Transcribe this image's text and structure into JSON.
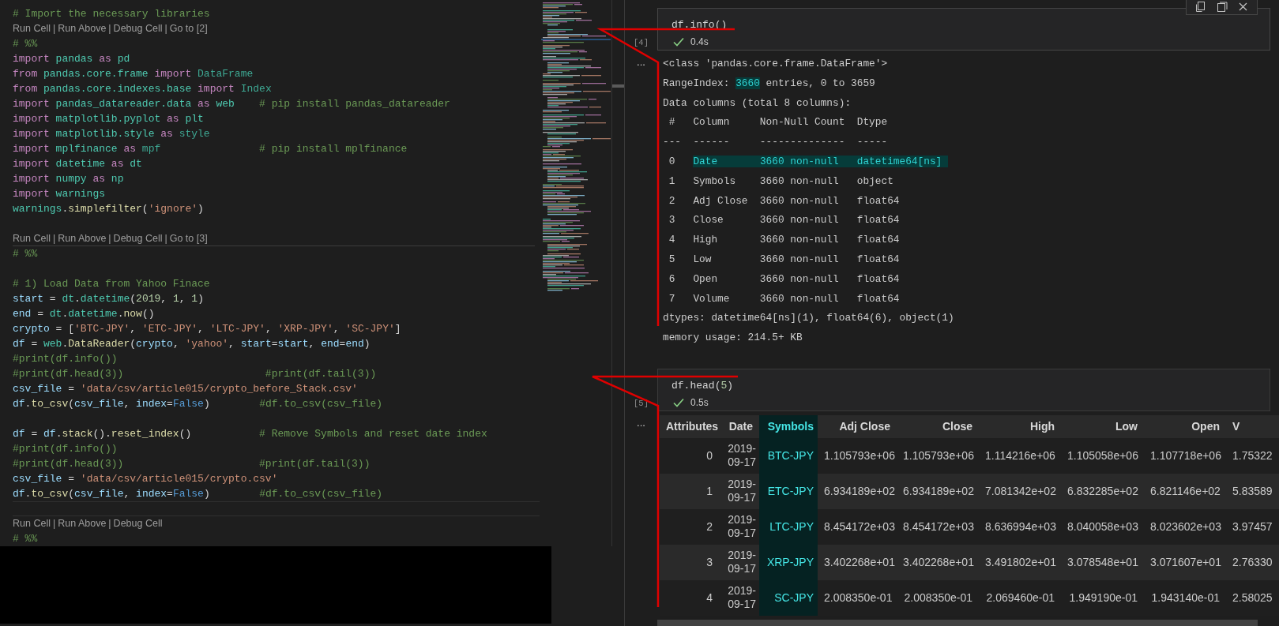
{
  "editor": {
    "lines": [
      {
        "kind": "code",
        "tokens": [
          {
            "text": "# Import the necessary libraries",
            "kind": "comment"
          }
        ]
      },
      {
        "kind": "codelens",
        "boundary": false,
        "separator": "|",
        "links": [
          "Run Cell",
          "Run Above",
          "Debug Cell",
          "Go to [2]"
        ]
      },
      {
        "kind": "code",
        "tokens": [
          {
            "text": "# %%",
            "kind": "comment"
          }
        ]
      },
      {
        "kind": "code",
        "tokens": [
          {
            "text": "import ",
            "kind": "keyword"
          },
          {
            "text": "pandas ",
            "kind": "module"
          },
          {
            "text": "as ",
            "kind": "keyword"
          },
          {
            "text": "pd",
            "kind": "module"
          }
        ]
      },
      {
        "kind": "code",
        "tokens": [
          {
            "text": "from ",
            "kind": "keyword"
          },
          {
            "text": "pandas.core.frame ",
            "kind": "module"
          },
          {
            "text": "import ",
            "kind": "keyword"
          },
          {
            "text": "DataFrame",
            "kind": "class"
          }
        ]
      },
      {
        "kind": "code",
        "tokens": [
          {
            "text": "from ",
            "kind": "keyword"
          },
          {
            "text": "pandas.core.indexes.base ",
            "kind": "module"
          },
          {
            "text": "import ",
            "kind": "keyword"
          },
          {
            "text": "Index",
            "kind": "class"
          }
        ]
      },
      {
        "kind": "code",
        "tokens": [
          {
            "text": "import ",
            "kind": "keyword"
          },
          {
            "text": "pandas_datareader.data ",
            "kind": "module"
          },
          {
            "text": "as ",
            "kind": "keyword"
          },
          {
            "text": "web    ",
            "kind": "module"
          },
          {
            "text": "# pip install pandas_datareader",
            "kind": "comment"
          }
        ]
      },
      {
        "kind": "code",
        "tokens": [
          {
            "text": "import ",
            "kind": "keyword"
          },
          {
            "text": "matplotlib.pyplot ",
            "kind": "module"
          },
          {
            "text": "as ",
            "kind": "keyword"
          },
          {
            "text": "plt",
            "kind": "module"
          }
        ]
      },
      {
        "kind": "code",
        "tokens": [
          {
            "text": "import ",
            "kind": "keyword"
          },
          {
            "text": "matplotlib.style ",
            "kind": "module"
          },
          {
            "text": "as ",
            "kind": "keyword"
          },
          {
            "text": "style",
            "kind": "class"
          }
        ]
      },
      {
        "kind": "code",
        "tokens": [
          {
            "text": "import ",
            "kind": "keyword"
          },
          {
            "text": "mplfinance ",
            "kind": "module"
          },
          {
            "text": "as ",
            "kind": "keyword"
          },
          {
            "text": "mpf                ",
            "kind": "class"
          },
          {
            "text": "# pip install mplfinance",
            "kind": "comment"
          }
        ]
      },
      {
        "kind": "code",
        "tokens": [
          {
            "text": "import ",
            "kind": "keyword"
          },
          {
            "text": "datetime ",
            "kind": "module"
          },
          {
            "text": "as ",
            "kind": "keyword"
          },
          {
            "text": "dt",
            "kind": "module"
          }
        ]
      },
      {
        "kind": "code",
        "tokens": [
          {
            "text": "import ",
            "kind": "keyword"
          },
          {
            "text": "numpy ",
            "kind": "module"
          },
          {
            "text": "as ",
            "kind": "keyword"
          },
          {
            "text": "np",
            "kind": "module"
          }
        ]
      },
      {
        "kind": "code",
        "tokens": [
          {
            "text": "import ",
            "kind": "keyword"
          },
          {
            "text": "warnings",
            "kind": "module"
          }
        ]
      },
      {
        "kind": "code",
        "tokens": [
          {
            "text": "warnings",
            "kind": "module"
          },
          {
            "text": ".",
            "kind": "plain"
          },
          {
            "text": "simplefilter",
            "kind": "function"
          },
          {
            "text": "(",
            "kind": "plain"
          },
          {
            "text": "'ignore'",
            "kind": "string"
          },
          {
            "text": ")",
            "kind": "plain"
          }
        ]
      },
      {
        "kind": "blank"
      },
      {
        "kind": "codelens",
        "boundary": true,
        "separator": "|",
        "links": [
          "Run Cell",
          "Run Above",
          "Debug Cell",
          "Go to [3]"
        ]
      },
      {
        "kind": "code",
        "tokens": [
          {
            "text": "# %%",
            "kind": "comment"
          }
        ]
      },
      {
        "kind": "blank"
      },
      {
        "kind": "code",
        "tokens": [
          {
            "text": "# 1) Load Data from Yahoo Finace",
            "kind": "comment"
          }
        ]
      },
      {
        "kind": "code",
        "tokens": [
          {
            "text": "start",
            "kind": "variable"
          },
          {
            "text": " = ",
            "kind": "plain"
          },
          {
            "text": "dt",
            "kind": "module"
          },
          {
            "text": ".",
            "kind": "plain"
          },
          {
            "text": "datetime",
            "kind": "module"
          },
          {
            "text": "(",
            "kind": "plain"
          },
          {
            "text": "2019",
            "kind": "number"
          },
          {
            "text": ", ",
            "kind": "plain"
          },
          {
            "text": "1",
            "kind": "number"
          },
          {
            "text": ", ",
            "kind": "plain"
          },
          {
            "text": "1",
            "kind": "number"
          },
          {
            "text": ")",
            "kind": "plain"
          }
        ]
      },
      {
        "kind": "code",
        "tokens": [
          {
            "text": "end",
            "kind": "variable"
          },
          {
            "text": " = ",
            "kind": "plain"
          },
          {
            "text": "dt",
            "kind": "module"
          },
          {
            "text": ".",
            "kind": "plain"
          },
          {
            "text": "datetime",
            "kind": "module"
          },
          {
            "text": ".",
            "kind": "plain"
          },
          {
            "text": "now",
            "kind": "function"
          },
          {
            "text": "()",
            "kind": "plain"
          }
        ]
      },
      {
        "kind": "code",
        "tokens": [
          {
            "text": "crypto",
            "kind": "variable"
          },
          {
            "text": " = [",
            "kind": "plain"
          },
          {
            "text": "'BTC-JPY'",
            "kind": "string"
          },
          {
            "text": ", ",
            "kind": "plain"
          },
          {
            "text": "'ETC-JPY'",
            "kind": "string"
          },
          {
            "text": ", ",
            "kind": "plain"
          },
          {
            "text": "'LTC-JPY'",
            "kind": "string"
          },
          {
            "text": ", ",
            "kind": "plain"
          },
          {
            "text": "'XRP-JPY'",
            "kind": "string"
          },
          {
            "text": ", ",
            "kind": "plain"
          },
          {
            "text": "'SC-JPY'",
            "kind": "string"
          },
          {
            "text": "]",
            "kind": "plain"
          }
        ]
      },
      {
        "kind": "code",
        "tokens": [
          {
            "text": "df",
            "kind": "variable"
          },
          {
            "text": " = ",
            "kind": "plain"
          },
          {
            "text": "web",
            "kind": "module"
          },
          {
            "text": ".",
            "kind": "plain"
          },
          {
            "text": "DataReader",
            "kind": "function"
          },
          {
            "text": "(",
            "kind": "plain"
          },
          {
            "text": "crypto",
            "kind": "variable"
          },
          {
            "text": ", ",
            "kind": "plain"
          },
          {
            "text": "'yahoo'",
            "kind": "string"
          },
          {
            "text": ", ",
            "kind": "plain"
          },
          {
            "text": "start",
            "kind": "variable"
          },
          {
            "text": "=",
            "kind": "plain"
          },
          {
            "text": "start",
            "kind": "variable"
          },
          {
            "text": ", ",
            "kind": "plain"
          },
          {
            "text": "end",
            "kind": "variable"
          },
          {
            "text": "=",
            "kind": "plain"
          },
          {
            "text": "end",
            "kind": "variable"
          },
          {
            "text": ")",
            "kind": "plain"
          }
        ]
      },
      {
        "kind": "code",
        "tokens": [
          {
            "text": "#print(df.info())",
            "kind": "comment"
          }
        ]
      },
      {
        "kind": "code",
        "tokens": [
          {
            "text": "#print(df.head(3))                       #print(df.tail(3))",
            "kind": "comment"
          }
        ]
      },
      {
        "kind": "code",
        "tokens": [
          {
            "text": "csv_file",
            "kind": "variable"
          },
          {
            "text": " = ",
            "kind": "plain"
          },
          {
            "text": "'data/csv/article015/crypto_before_Stack.csv'",
            "kind": "string"
          }
        ]
      },
      {
        "kind": "code",
        "tokens": [
          {
            "text": "df",
            "kind": "variable"
          },
          {
            "text": ".",
            "kind": "plain"
          },
          {
            "text": "to_csv",
            "kind": "function"
          },
          {
            "text": "(",
            "kind": "plain"
          },
          {
            "text": "csv_file",
            "kind": "variable"
          },
          {
            "text": ", ",
            "kind": "plain"
          },
          {
            "text": "index",
            "kind": "variable"
          },
          {
            "text": "=",
            "kind": "plain"
          },
          {
            "text": "False",
            "kind": "constant"
          },
          {
            "text": ")        ",
            "kind": "plain"
          },
          {
            "text": "#df.to_csv(csv_file)",
            "kind": "comment"
          }
        ]
      },
      {
        "kind": "blank"
      },
      {
        "kind": "code",
        "tokens": [
          {
            "text": "df",
            "kind": "variable"
          },
          {
            "text": " = ",
            "kind": "plain"
          },
          {
            "text": "df",
            "kind": "variable"
          },
          {
            "text": ".",
            "kind": "plain"
          },
          {
            "text": "stack",
            "kind": "function"
          },
          {
            "text": "().",
            "kind": "plain"
          },
          {
            "text": "reset_index",
            "kind": "function"
          },
          {
            "text": "()           ",
            "kind": "plain"
          },
          {
            "text": "# Remove Symbols and reset date index",
            "kind": "comment"
          }
        ]
      },
      {
        "kind": "code",
        "tokens": [
          {
            "text": "#print(df.info())",
            "kind": "comment"
          }
        ]
      },
      {
        "kind": "code",
        "tokens": [
          {
            "text": "#print(df.head(3))                      #print(df.tail(3))",
            "kind": "comment"
          }
        ]
      },
      {
        "kind": "code",
        "tokens": [
          {
            "text": "csv_file",
            "kind": "variable"
          },
          {
            "text": " = ",
            "kind": "plain"
          },
          {
            "text": "'data/csv/article015/crypto.csv'",
            "kind": "string"
          }
        ]
      },
      {
        "kind": "code",
        "tokens": [
          {
            "text": "df",
            "kind": "variable"
          },
          {
            "text": ".",
            "kind": "plain"
          },
          {
            "text": "to_csv",
            "kind": "function"
          },
          {
            "text": "(",
            "kind": "plain"
          },
          {
            "text": "csv_file",
            "kind": "variable"
          },
          {
            "text": ", ",
            "kind": "plain"
          },
          {
            "text": "index",
            "kind": "variable"
          },
          {
            "text": "=",
            "kind": "plain"
          },
          {
            "text": "False",
            "kind": "constant"
          },
          {
            "text": ")        ",
            "kind": "plain"
          },
          {
            "text": "#df.to_csv(csv_file)",
            "kind": "comment"
          }
        ]
      },
      {
        "kind": "empty-cell"
      },
      {
        "kind": "codelens",
        "boundary": false,
        "separator": "|",
        "links": [
          "Run Cell",
          "Run Above",
          "Debug Cell"
        ]
      },
      {
        "kind": "code",
        "tokens": [
          {
            "text": "# %%",
            "kind": "comment"
          }
        ]
      }
    ]
  },
  "notebook": {
    "cells": [
      {
        "count": "[4]",
        "focused": true,
        "duration": "0.4s",
        "output_marker": "...",
        "code": [
          {
            "text": "df",
            "kind": "plain"
          },
          {
            "text": ".",
            "kind": "plain"
          },
          {
            "text": "info",
            "kind": "plain"
          },
          {
            "text": "()",
            "kind": "plain"
          }
        ],
        "output": {
          "kind": "text",
          "lines": [
            {
              "segments": [
                {
                  "text": "<class 'pandas.core.frame.DataFrame'>",
                  "highlighted": false
                }
              ]
            },
            {
              "segments": [
                {
                  "text": "RangeIndex: ",
                  "highlighted": false
                },
                {
                  "text": "3660",
                  "highlighted": true
                },
                {
                  "text": " entries, 0 to 3659",
                  "highlighted": false
                }
              ]
            },
            {
              "segments": [
                {
                  "text": "Data columns (total 8 columns):",
                  "highlighted": false
                }
              ]
            },
            {
              "segments": [
                {
                  "text": " #   Column     Non-Null Count  Dtype",
                  "highlighted": false
                }
              ]
            },
            {
              "segments": [
                {
                  "text": "---  ------     --------------  -----",
                  "highlighted": false
                }
              ]
            },
            {
              "segments": [
                {
                  "text": " 0   ",
                  "highlighted": false
                },
                {
                  "text": "Date       3660 non-null   datetime64[ns]",
                  "highlighted": true
                }
              ]
            },
            {
              "segments": [
                {
                  "text": " 1   Symbols    3660 non-null   object",
                  "highlighted": false
                }
              ]
            },
            {
              "segments": [
                {
                  "text": " 2   Adj Close  3660 non-null   float64",
                  "highlighted": false
                }
              ]
            },
            {
              "segments": [
                {
                  "text": " 3   Close      3660 non-null   float64",
                  "highlighted": false
                }
              ]
            },
            {
              "segments": [
                {
                  "text": " 4   High       3660 non-null   float64",
                  "highlighted": false
                }
              ]
            },
            {
              "segments": [
                {
                  "text": " 5   Low        3660 non-null   float64",
                  "highlighted": false
                }
              ]
            },
            {
              "segments": [
                {
                  "text": " 6   Open       3660 non-null   float64",
                  "highlighted": false
                }
              ]
            },
            {
              "segments": [
                {
                  "text": " 7   Volume     3660 non-null   float64",
                  "highlighted": false
                }
              ]
            },
            {
              "segments": [
                {
                  "text": "dtypes: datetime64[ns](1), float64(6), object(1)",
                  "highlighted": false
                }
              ]
            },
            {
              "segments": [
                {
                  "text": "memory usage: 214.5+ KB",
                  "highlighted": false
                }
              ]
            }
          ]
        }
      },
      {
        "count": "[5]",
        "focused": false,
        "duration": "0.5s",
        "output_marker": "...",
        "code": [
          {
            "text": "df",
            "kind": "plain"
          },
          {
            "text": ".",
            "kind": "plain"
          },
          {
            "text": "head",
            "kind": "plain"
          },
          {
            "text": "(",
            "kind": "plain"
          },
          {
            "text": "5",
            "kind": "number"
          },
          {
            "text": ")",
            "kind": "plain"
          }
        ],
        "output": {
          "kind": "table",
          "columns": [
            {
              "label": "Attributes",
              "highlighted": false
            },
            {
              "label": "Date",
              "highlighted": false
            },
            {
              "label": "Symbols",
              "highlighted": true
            },
            {
              "label": "Adj Close",
              "highlighted": false
            },
            {
              "label": "Close",
              "highlighted": false
            },
            {
              "label": "High",
              "highlighted": false
            },
            {
              "label": "Low",
              "highlighted": false
            },
            {
              "label": "Open",
              "highlighted": false
            },
            {
              "label": "V",
              "highlighted": false
            }
          ],
          "rows": [
            [
              "0",
              "2019-09-17",
              "BTC-JPY",
              "1.105793e+06",
              "1.105793e+06",
              "1.114216e+06",
              "1.105058e+06",
              "1.107718e+06",
              "1.75322"
            ],
            [
              "1",
              "2019-09-17",
              "ETC-JPY",
              "6.934189e+02",
              "6.934189e+02",
              "7.081342e+02",
              "6.832285e+02",
              "6.821146e+02",
              "5.83589"
            ],
            [
              "2",
              "2019-09-17",
              "LTC-JPY",
              "8.454172e+03",
              "8.454172e+03",
              "8.636994e+03",
              "8.040058e+03",
              "8.023602e+03",
              "3.97457"
            ],
            [
              "3",
              "2019-09-17",
              "XRP-JPY",
              "3.402268e+01",
              "3.402268e+01",
              "3.491802e+01",
              "3.078548e+01",
              "3.071607e+01",
              "2.76330"
            ],
            [
              "4",
              "2019-09-17",
              "SC-JPY",
              "2.008350e-01",
              "2.008350e-01",
              "2.069460e-01",
              "1.949190e-01",
              "1.943140e-01",
              "2.58025"
            ]
          ]
        }
      }
    ]
  }
}
